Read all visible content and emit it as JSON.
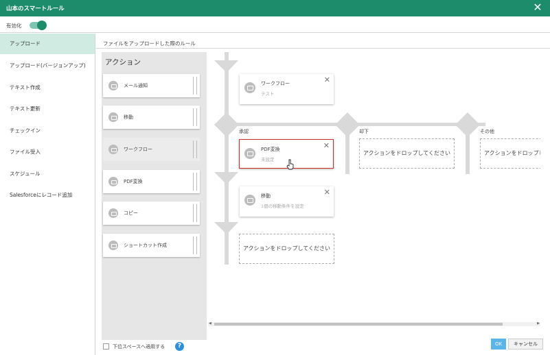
{
  "window": {
    "title": "山本のスマートルール"
  },
  "enable": {
    "label": "有効化",
    "on": true
  },
  "sidebar": {
    "items": [
      {
        "label": "アップロード",
        "active": true
      },
      {
        "label": "アップロード(バージョンアップ)"
      },
      {
        "label": "テキスト作成"
      },
      {
        "label": "テキスト更新"
      },
      {
        "label": "チェックイン"
      },
      {
        "label": "ファイル受入"
      },
      {
        "label": "スケジュール"
      },
      {
        "label": "Salesforceにレコード追加"
      }
    ]
  },
  "main": {
    "heading": "ファイルをアップロードした際のルール"
  },
  "palette": {
    "title": "アクション",
    "items": [
      {
        "label": "メール通知",
        "icon": "mail-icon"
      },
      {
        "label": "移動",
        "icon": "move-icon"
      },
      {
        "label": "ワークフロー",
        "icon": "workflow-icon",
        "disabled": true
      },
      {
        "label": "PDF変換",
        "icon": "pdf-icon"
      },
      {
        "label": "コピー",
        "icon": "copy-icon"
      },
      {
        "label": "ショートカット作成",
        "icon": "shortcut-icon"
      }
    ]
  },
  "flow": {
    "workflow_node": {
      "title": "ワークフロー",
      "subtitle": "テスト"
    },
    "branches": {
      "approve": "承認",
      "reject": "却下",
      "other": "その他"
    },
    "pdf_node": {
      "title": "PDF変換",
      "subtitle": "未設定"
    },
    "move_node": {
      "title": "移動",
      "subtitle": "1個の移動条件を設定"
    },
    "drop_text": "アクションをドロップしてください",
    "close_symbol": "✕"
  },
  "footer": {
    "checkbox_label": "下位スペースへ適用する",
    "help": "?",
    "ok": "OK",
    "cancel": "キャンセル"
  },
  "colors": {
    "header": "#1d8c6a",
    "active_nav": "#d0ece2",
    "selected_border": "#c9302c",
    "ok_button": "#5bb5e8",
    "flow_line": "#d9d9d9"
  }
}
